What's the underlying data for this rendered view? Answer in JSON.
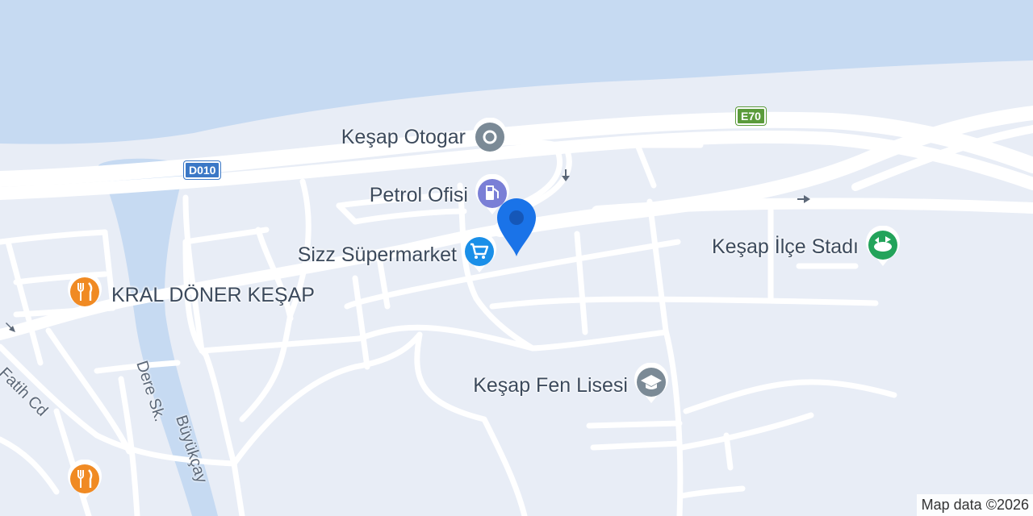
{
  "map": {
    "places": [
      {
        "name": "Keşap Otogar",
        "category": "bus-station",
        "color": "#7b8a96"
      },
      {
        "name": "Petrol Ofisi",
        "category": "gas-station",
        "color": "#7a7fd6"
      },
      {
        "name": "Sizz Süpermarket",
        "category": "supermarket",
        "color": "#1a8fe8"
      },
      {
        "name": "KRAL DÖNER KEŞAP",
        "category": "restaurant",
        "color": "#f08a23"
      },
      {
        "name": "Keşap İlçe Stadı",
        "category": "stadium",
        "color": "#23a35a"
      },
      {
        "name": "Keşap Fen Lisesi",
        "category": "school",
        "color": "#7b8a96"
      }
    ],
    "unnamed_places": [
      {
        "category": "restaurant",
        "color": "#f08a23"
      }
    ],
    "streets": {
      "fatih": "Fatih Cd",
      "dere": "Dere Sk.",
      "river": "Büyükçay"
    },
    "shields": {
      "d010": "D010",
      "e70": "E70"
    },
    "shield_colors": {
      "d010": "#3b78c6",
      "e70": "#5b9b3b"
    },
    "marker": {
      "color": "#1a73e8"
    },
    "water_color": "#c6daf2",
    "land_color": "#e8edf6",
    "road_color": "#ffffff"
  },
  "attribution": "Map data ©2026"
}
